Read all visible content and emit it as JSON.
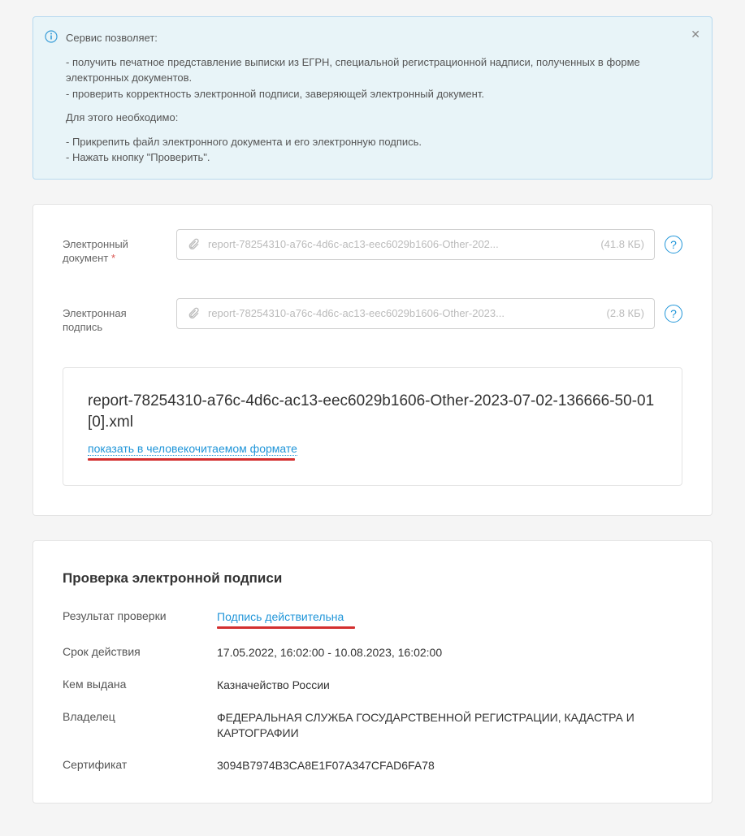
{
  "info": {
    "heading": "Сервис позволяет:",
    "bullet1": "- получить печатное представление выписки из ЕГРН, специальной регистрационной надписи, полученных в форме электронных документов.",
    "bullet2": "- проверить корректность электронной подписи, заверяющей электронный документ.",
    "req_heading": "Для этого необходимо:",
    "req1": "- Прикрепить файл электронного документа и его электронную подпись.",
    "req2": "- Нажать кнопку \"Проверить\"."
  },
  "form": {
    "doc_label": "Электронный документ",
    "doc_required": "*",
    "doc_filename": "report-78254310-a76c-4d6c-ac13-eec6029b1606-Other-202...",
    "doc_size": "(41.8 КБ)",
    "sig_label": "Электронная подпись",
    "sig_filename": "report-78254310-a76c-4d6c-ac13-eec6029b1606-Other-2023...",
    "sig_size": "(2.8 КБ)"
  },
  "report": {
    "filename": "report-78254310-a76c-4d6c-ac13-eec6029b1606-Other-2023-07-02-136666-50-01[0].xml",
    "show_link": "показать в человекочитаемом формате"
  },
  "verify": {
    "title": "Проверка электронной подписи",
    "rows": {
      "result_label": "Результат проверки",
      "result_value": "Подпись действительна",
      "validity_label": "Срок действия",
      "validity_value": "17.05.2022, 16:02:00 - 10.08.2023, 16:02:00",
      "issuer_label": "Кем выдана",
      "issuer_value": "Казначейство России",
      "owner_label": "Владелец",
      "owner_value": "ФЕДЕРАЛЬНАЯ СЛУЖБА ГОСУДАРСТВЕННОЙ РЕГИСТРАЦИИ, КАДАСТРА И КАРТОГРАФИИ",
      "cert_label": "Сертификат",
      "cert_value": "3094B7974B3CA8E1F07A347CFAD6FA78"
    }
  }
}
